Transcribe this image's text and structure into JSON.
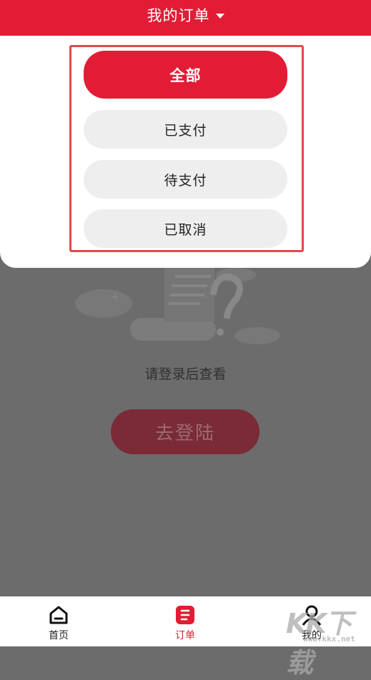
{
  "header": {
    "title": "我的订单"
  },
  "filter": {
    "options": [
      {
        "label": "全部",
        "active": true
      },
      {
        "label": "已支付",
        "active": false
      },
      {
        "label": "待支付",
        "active": false
      },
      {
        "label": "已取消",
        "active": false
      }
    ]
  },
  "empty_state": {
    "message": "请登录后查看",
    "login_button": "去登陆"
  },
  "bottom_nav": [
    {
      "label": "首页",
      "icon": "home-icon"
    },
    {
      "label": "订单",
      "icon": "order-icon",
      "active": true
    },
    {
      "label": "我的",
      "icon": "person-icon"
    }
  ],
  "watermark": {
    "text": "KK下载",
    "site": "www.kkx.net"
  },
  "colors": {
    "accent": "#e31c35",
    "overlay": "#6c6c6c",
    "option_bg": "#eeeeee"
  }
}
